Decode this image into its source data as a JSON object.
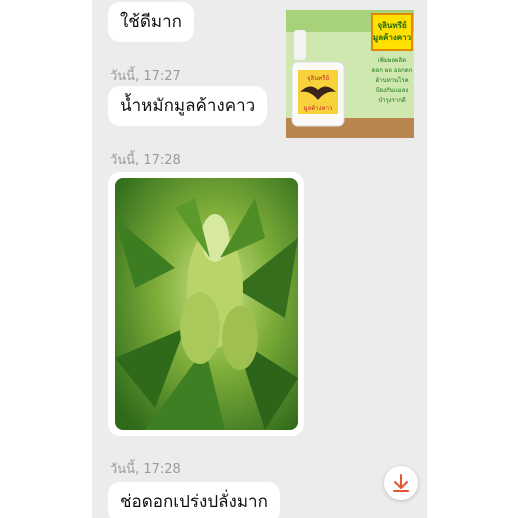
{
  "messages": {
    "m1": "ใช้ดีมาก",
    "ts1": "วันนี้, 17:27",
    "m2": "น้ำหมักมูลค้างคาว",
    "ts2": "วันนี้, 17:28",
    "ts3": "วันนี้, 17:28",
    "m3": "ช่อดอกเปร่งปลั่งมาก"
  },
  "product": {
    "title_line1": "จุลินทรีย์",
    "title_line2": "มูลค้างคาว",
    "label_line1": "จุลินทรีย์",
    "label_line2": "มูลค้างคาว",
    "benefits": [
      "เพิ่มผลผลิต",
      "ดอก ผล ออกดก",
      "ต้านทานโรค",
      "ป้องกันแมลง",
      "บำรุงรากดี"
    ]
  },
  "colors": {
    "chat_bg": "#ececec",
    "bubble_bg": "#ffffff",
    "timestamp": "#9a9a9a",
    "download_arrow": "#e4572e",
    "poster_title_bg": "#ffe000",
    "poster_green": "#3d8b1f"
  },
  "icons": {
    "download": "download-arrow-icon"
  }
}
